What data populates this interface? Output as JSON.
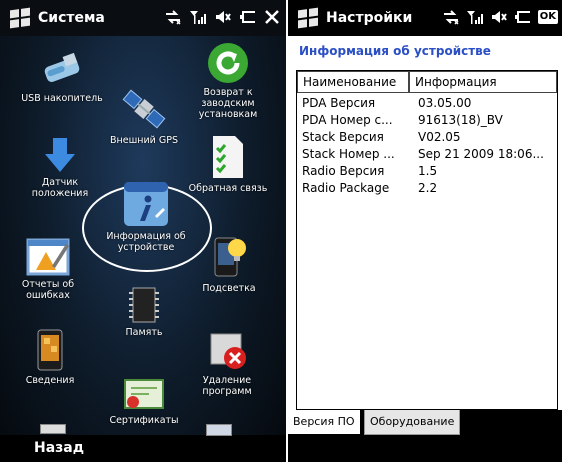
{
  "left": {
    "title": "Система",
    "apps": [
      {
        "label": "USB накопитель",
        "icon": "usb-drive-icon"
      },
      {
        "label": "Возврат к\nзаводским\nустановкам",
        "icon": "reset-arrow-icon"
      },
      {
        "label": "Внешний GPS",
        "icon": "satellite-icon"
      },
      {
        "label": "Датчик\nположения",
        "icon": "down-arrow-icon"
      },
      {
        "label": "Обратная связь",
        "icon": "checklist-icon"
      },
      {
        "label": "Информация об\nустройстве",
        "icon": "device-info-icon"
      },
      {
        "label": "Отчеты об\nошибках",
        "icon": "error-report-icon"
      },
      {
        "label": "Подсветка",
        "icon": "backlight-icon"
      },
      {
        "label": "Память",
        "icon": "memory-chip-icon"
      },
      {
        "label": "Сведения",
        "icon": "phone-info-icon"
      },
      {
        "label": "Удаление\nпрограмм",
        "icon": "remove-program-icon"
      },
      {
        "label": "Сертификаты",
        "icon": "certificate-icon"
      }
    ],
    "softkey": "Назад"
  },
  "right": {
    "title": "Настройки",
    "ok_label": "OK",
    "header": "Информация об устройстве",
    "columns": [
      "Наименование",
      "Информация"
    ],
    "rows": [
      [
        "PDA Версия",
        "03.05.00"
      ],
      [
        "PDA Номер с...",
        "91613(18)_BV"
      ],
      [
        "Stack Версия",
        "V02.05"
      ],
      [
        "Stack Номер ...",
        "Sep 21 2009 18:06..."
      ],
      [
        "Radio Версия",
        "1.5"
      ],
      [
        "Radio Package",
        "2.2"
      ]
    ],
    "tabs": [
      "Версия ПО",
      "Оборудование"
    ]
  }
}
